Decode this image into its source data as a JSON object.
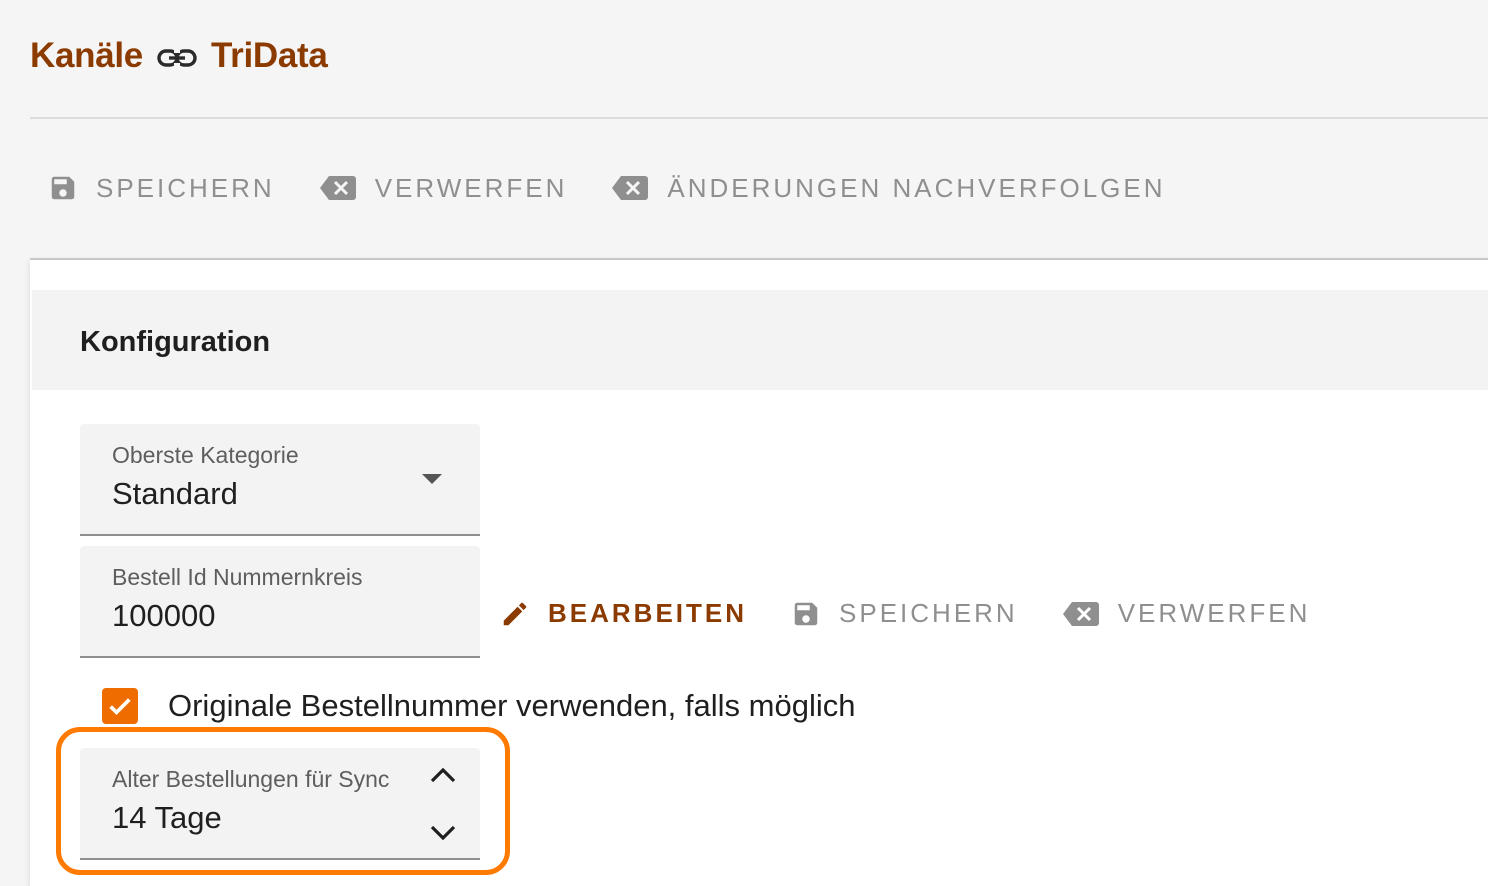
{
  "breadcrumb": {
    "section": "Kanäle",
    "channel": "TriData"
  },
  "toolbar": {
    "save_label": "SPEICHERN",
    "discard_label": "VERWERFEN",
    "track_changes_label": "ÄNDERUNGEN NACHVERFOLGEN"
  },
  "config": {
    "title": "Konfiguration",
    "top_category": {
      "label": "Oberste Kategorie",
      "value": "Standard"
    },
    "order_id_range": {
      "label": "Bestell Id Nummernkreis",
      "value": "100000"
    },
    "inline_actions": {
      "edit_label": "BEARBEITEN",
      "save_label": "SPEICHERN",
      "discard_label": "VERWERFEN"
    },
    "use_original_order_number": {
      "label": "Originale Bestellnummer verwenden, falls möglich",
      "checked": true
    },
    "order_age_sync": {
      "label": "Alter Bestellungen für Sync",
      "value": "14 Tage"
    }
  },
  "colors": {
    "brand": "#8b3a00",
    "accent": "#ef6c00",
    "highlight": "#ff7a00"
  }
}
